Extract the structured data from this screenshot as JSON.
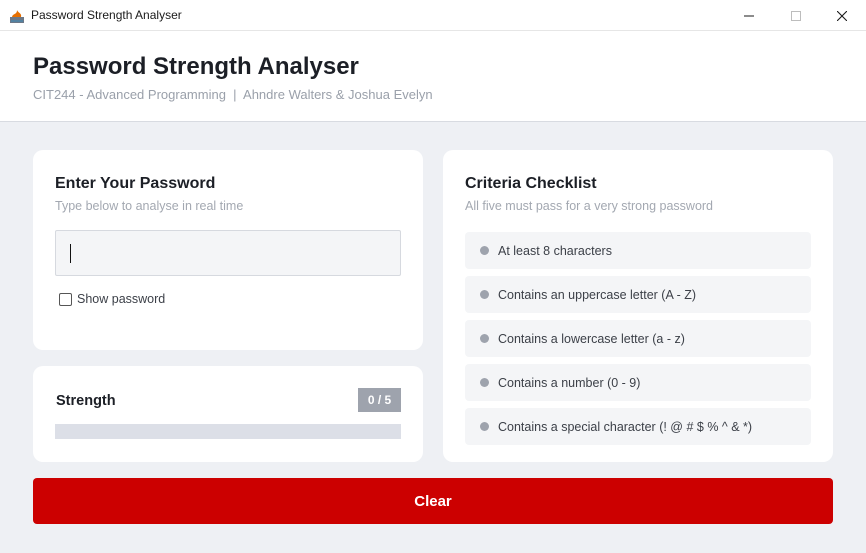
{
  "window": {
    "title": "Password Strength Analyser",
    "controls": [
      "minimize-icon",
      "maximize-icon",
      "close-icon"
    ]
  },
  "header": {
    "title": "Password Strength Analyser",
    "subtitle": "CIT244 - Advanced Programming  |  Ahndre Walters & Joshua Evelyn"
  },
  "password_card": {
    "title": "Enter Your Password",
    "hint": "Type below to analyse in real time",
    "input_value": "",
    "show_password_label": "Show password",
    "show_password_checked": false
  },
  "strength": {
    "label": "Strength",
    "score": "0 / 5",
    "fill_fraction": 0
  },
  "criteria": {
    "title": "Criteria Checklist",
    "hint": "All five must pass for a very strong password",
    "items": [
      {
        "label": "At least 8 characters",
        "passed": false
      },
      {
        "label": "Contains an uppercase letter (A - Z)",
        "passed": false
      },
      {
        "label": "Contains a lowercase letter (a - z)",
        "passed": false
      },
      {
        "label": "Contains a number (0 - 9)",
        "passed": false
      },
      {
        "label": "Contains a special character (! @ # $ % ^ & *)",
        "passed": false
      }
    ]
  },
  "actions": {
    "clear_label": "Clear"
  },
  "colors": {
    "accent": "#cc0000",
    "neutral_indicator": "#9ea3ad",
    "background": "#eef0f4"
  }
}
